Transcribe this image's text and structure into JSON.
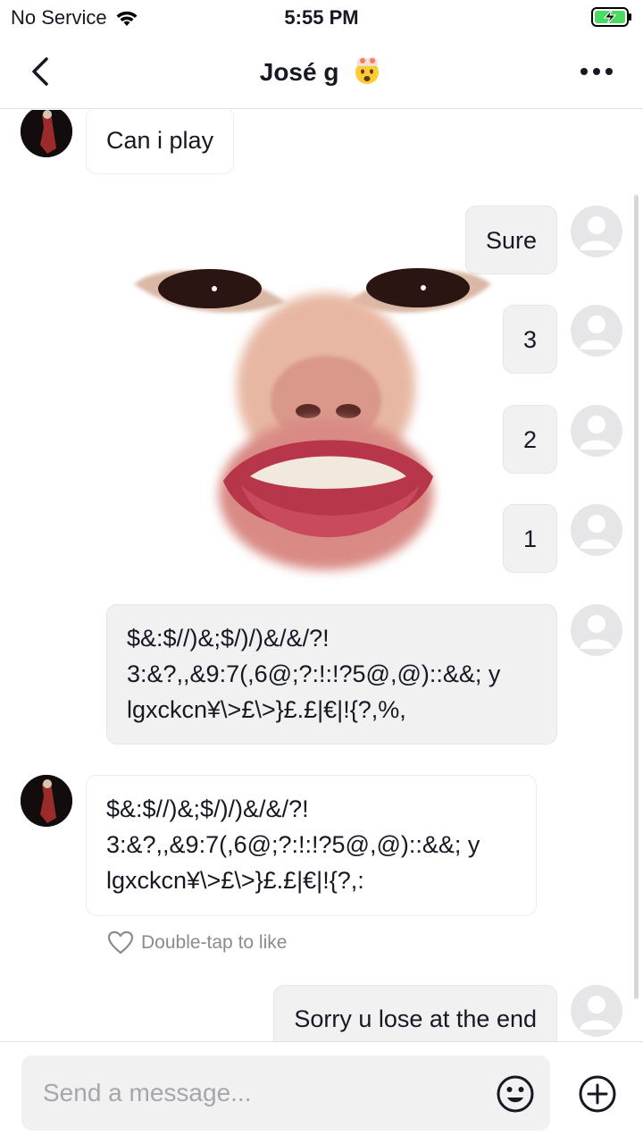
{
  "status_bar": {
    "carrier": "No Service",
    "time": "5:55 PM"
  },
  "header": {
    "title": "José g"
  },
  "messages": [
    {
      "from": "other",
      "text": "Can i play"
    },
    {
      "from": "me",
      "text": "Sure"
    },
    {
      "from": "me",
      "text": "3"
    },
    {
      "from": "me",
      "text": "2"
    },
    {
      "from": "me",
      "text": "1"
    },
    {
      "from": "me",
      "lines": [
        "$&:$//)&;$/)/)&/&/?!",
        "3:&?,,&9:7(,6@;?:!:!?5@,@)::&&; y",
        "lgxckcn¥\\>£\\>}£.£|€|!{?,%,"
      ]
    },
    {
      "from": "other",
      "lines": [
        "$&:$//)&;$/)/)&/&/?!",
        "3:&?,,&9:7(,6@;?:!:!?5@,@)::&&; y",
        "lgxckcn¥\\>£\\>}£.£|€|!{?,:"
      ]
    },
    {
      "from": "me",
      "text": "Sorry u lose at the end"
    }
  ],
  "like_hint": "Double-tap to like",
  "composer": {
    "placeholder": "Send a message..."
  },
  "colors": {
    "bubble_me": "#f1f1f2",
    "text": "#161823",
    "hint": "#8a8b91"
  }
}
